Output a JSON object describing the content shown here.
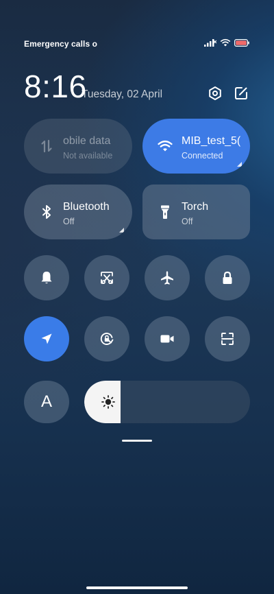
{
  "status_bar": {
    "carrier_text": "Emergency calls o"
  },
  "header": {
    "time": "8:16",
    "date": "Tuesday, 02 April"
  },
  "tiles": {
    "mobile_data": {
      "title": "obile data",
      "subtitle": "Not available",
      "on": false
    },
    "wifi": {
      "title": "MIB_test_5(",
      "subtitle": "Connected",
      "on": true
    },
    "bluetooth": {
      "title": "Bluetooth",
      "subtitle": "Off",
      "on": false
    },
    "torch": {
      "title": "Torch",
      "subtitle": "Off",
      "on": false
    }
  },
  "auto_brightness": {
    "label": "A"
  },
  "brightness": {
    "level": 0.22
  },
  "colors": {
    "accent": "#3a7ce8",
    "wifi_tile": "#3d7be6"
  }
}
